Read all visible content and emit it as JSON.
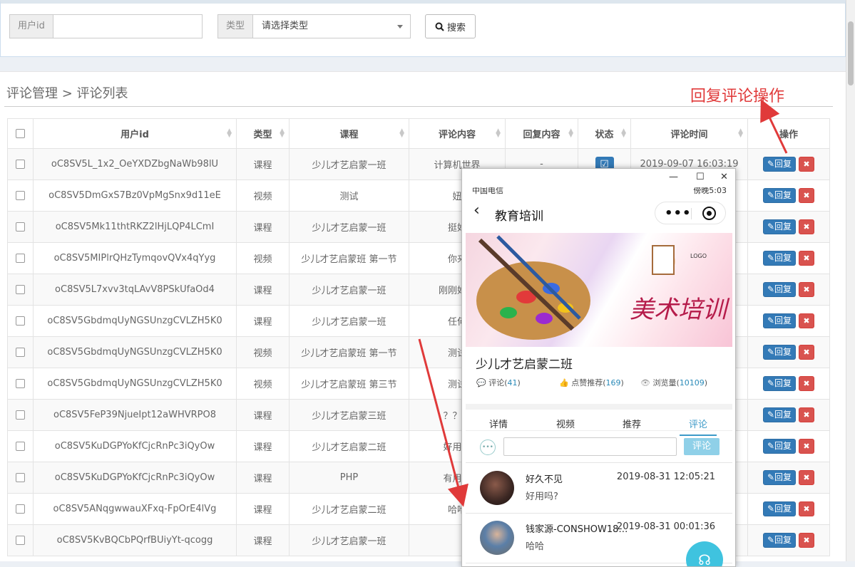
{
  "filter": {
    "user_id_label": "用户id",
    "user_id_value": "",
    "type_label": "类型",
    "type_selected": "请选择类型",
    "search_label": "搜索"
  },
  "breadcrumb": "评论管理 > 评论列表",
  "annotation": "回复评论操作",
  "table": {
    "headers": [
      "用户id",
      "类型",
      "课程",
      "评论内容",
      "回复内容",
      "状态",
      "评论时间",
      "操作"
    ],
    "reply_label": "回复",
    "rows": [
      {
        "user": "oC8SV5L_1x2_OeYXDZbgNaWb98lU",
        "type": "课程",
        "course": "少儿才艺启蒙一班",
        "content": "计算机世界",
        "reply": "-",
        "time": "2019-09-07 16:03:19"
      },
      {
        "user": "oC8SV5DmGxS7Bz0VpMgSnx9d11eE",
        "type": "视频",
        "course": "测试",
        "content": "妞",
        "reply": "",
        "time": ""
      },
      {
        "user": "oC8SV5Mk11thtRKZ2lHjLQP4LCmI",
        "type": "课程",
        "course": "少儿才艺启蒙一班",
        "content": "挺好",
        "reply": "",
        "time": ""
      },
      {
        "user": "oC8SV5MIPlrQHzTymqovQVx4qYyg",
        "type": "视频",
        "course": "少儿才艺启蒙班 第一节",
        "content": "你来",
        "reply": "",
        "time": ""
      },
      {
        "user": "oC8SV5L7xvv3tqLAvV8PSkUfaOd4",
        "type": "课程",
        "course": "少儿才艺启蒙一班",
        "content": "刚刚好还",
        "reply": "",
        "time": ""
      },
      {
        "user": "oC8SV5GbdmqUyNGSUnzgCVLZH5K0",
        "type": "课程",
        "course": "少儿才艺启蒙一班",
        "content": "任何",
        "reply": "",
        "time": ""
      },
      {
        "user": "oC8SV5GbdmqUyNGSUnzgCVLZH5K0",
        "type": "视频",
        "course": "少儿才艺启蒙班 第一节",
        "content": "测试",
        "reply": "",
        "time": ""
      },
      {
        "user": "oC8SV5GbdmqUyNGSUnzgCVLZH5K0",
        "type": "视频",
        "course": "少儿才艺启蒙班 第三节",
        "content": "测试",
        "reply": "",
        "time": ""
      },
      {
        "user": "oC8SV5FeP39NjueIpt12aWHVRPO8",
        "type": "课程",
        "course": "少儿才艺启蒙三班",
        "content": "？？？",
        "reply": "",
        "time": ""
      },
      {
        "user": "oC8SV5KuDGPYoKfCjcRnPc3iQyOw",
        "type": "课程",
        "course": "少儿才艺启蒙二班",
        "content": "好用吗",
        "reply": "",
        "time": ""
      },
      {
        "user": "oC8SV5KuDGPYoKfCjcRnPc3iQyOw",
        "type": "课程",
        "course": "PHP",
        "content": "有用吗",
        "reply": "",
        "time": ""
      },
      {
        "user": "oC8SV5ANqgwwauXFxq-FpOrE4lVg",
        "type": "课程",
        "course": "少儿才艺启蒙二班",
        "content": "哈哈",
        "reply": "",
        "time": ""
      },
      {
        "user": "oC8SV5KvBQCbPQrfBUiyYt-qcogg",
        "type": "课程",
        "course": "少儿才艺启蒙一班",
        "content": "",
        "reply": "",
        "time": ""
      }
    ]
  },
  "phone": {
    "carrier": "中国电信",
    "clock": "傍晚5:03",
    "nav_title": "教育培训",
    "banner_text": "美术培训",
    "banner_logo": "LOGO",
    "course_name": "少儿才艺启蒙二班",
    "stats": {
      "comments_label": "评论",
      "comments_value": "41",
      "likes_label": "点赞推荐",
      "likes_value": "169",
      "views_label": "浏览量",
      "views_value": "10109"
    },
    "tabs": [
      "详情",
      "视频",
      "推荐",
      "评论"
    ],
    "comment_button": "评论",
    "comments": [
      {
        "name": "好久不见",
        "time": "2019-08-31 12:05:21",
        "text": "好用吗?"
      },
      {
        "name": "钱家源-CONSHOW185…",
        "time": "2019-08-31 00:01:36",
        "text": "哈哈"
      }
    ]
  },
  "colors": {
    "primary": "#337ab7",
    "danger": "#d9534f",
    "annotation_red": "#e03a3a",
    "accent_blue": "#3c9ac8"
  }
}
